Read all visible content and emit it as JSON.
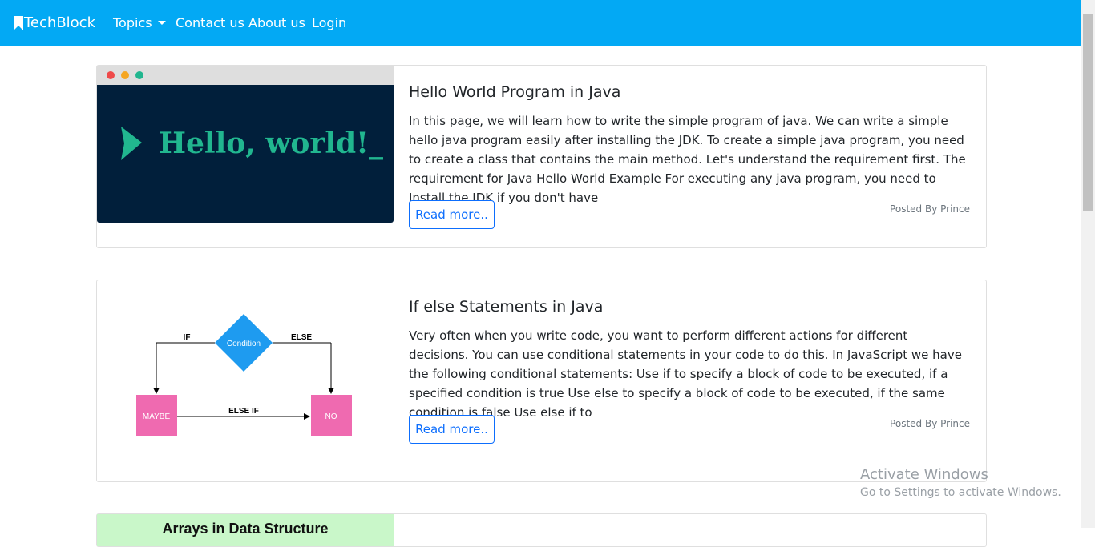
{
  "navbar": {
    "brand": "TechBlock",
    "items": [
      "Topics",
      "Contact us",
      "About us",
      "Login"
    ]
  },
  "posts": [
    {
      "title": "Hello World Program in Java",
      "excerpt": "In this page, we will learn how to write the simple program of java. We can write a simple hello java program easily after installing the JDK. To create a simple java program, you need to create a class that contains the main method. Let's understand the requirement first. The requirement for Java Hello World Example For executing any java program, you need to Install the JDK if you don't have",
      "read_more": "Read more..",
      "posted_by": "Posted By Prince",
      "image_text": "Hello, world!_"
    },
    {
      "title": "If else Statements in Java",
      "excerpt": "Very often when you write code, you want to perform different actions for different decisions. You can use conditional statements in your code to do this. In JavaScript we have the following conditional statements: Use if to specify a block of code to be executed, if a specified condition is true Use else to specify a block of code to be executed, if the same condition is false Use else if to",
      "read_more": "Read more..",
      "posted_by": "Posted By Prince",
      "diagram": {
        "condition": "Condition",
        "if_label": "IF",
        "else_label": "ELSE",
        "elseif_label": "ELSE IF",
        "maybe": "MAYBE",
        "no": "NO"
      }
    },
    {
      "image_text": "Arrays in Data Structure"
    }
  ],
  "watermark": {
    "title": "Activate Windows",
    "subtitle": "Go to Settings to activate Windows."
  },
  "colors": {
    "navbar": "#03a9f4",
    "link": "#0d6efd",
    "hello_bg": "#011f3b",
    "hello_text": "#21b68f",
    "condition": "#1e9bf0",
    "boxes": "#ef6ab0"
  }
}
